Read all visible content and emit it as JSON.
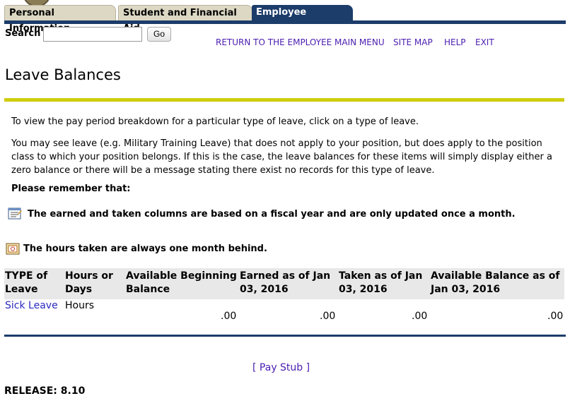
{
  "tabs": [
    {
      "label": "Personal Information"
    },
    {
      "label": "Student and Financial Aid"
    },
    {
      "label": "Employee Services"
    }
  ],
  "search": {
    "label": "Search",
    "value": "",
    "button": "Go"
  },
  "toplinks": [
    "RETURN TO THE EMPLOYEE MAIN MENU",
    "SITE MAP",
    "HELP",
    "EXIT"
  ],
  "page_title": "Leave Balances",
  "intro": {
    "p1": "To view the pay period breakdown for a particular type of leave, click on a type of leave.",
    "p2": "You may see leave (e.g. Military Training Leave) that does not apply to your position, but does apply to the position class to which your position belongs. If this is the case, the leave balances for these items will simply display either a zero balance or there will be a message stating there exist no records for this type of leave.",
    "remember": "Please remember that:",
    "note1": "The earned and taken columns are based on a fiscal year and are only updated once a month.",
    "note2": "The hours taken are always one month behind."
  },
  "icons": {
    "note1": "notepad-icon",
    "note2": "calendar-icon"
  },
  "table": {
    "headers": [
      "TYPE of Leave",
      "Hours or Days",
      "Available Beginning Balance",
      "Earned as of Jan 03, 2016",
      "Taken as of Jan 03, 2016",
      "Available Balance as of Jan 03, 2016"
    ],
    "rows": [
      {
        "type": "Sick Leave",
        "unit": "Hours",
        "beginning": ".00",
        "earned": ".00",
        "taken": ".00",
        "available": ".00"
      }
    ]
  },
  "footer": {
    "paystub_open": "[",
    "paystub": "Pay Stub",
    "paystub_close": "]",
    "release": "RELEASE: 8.10"
  },
  "colors": {
    "nav": "#1c3c6a",
    "accent_bar": "#cfcc0c",
    "link": "#4b1db0"
  }
}
